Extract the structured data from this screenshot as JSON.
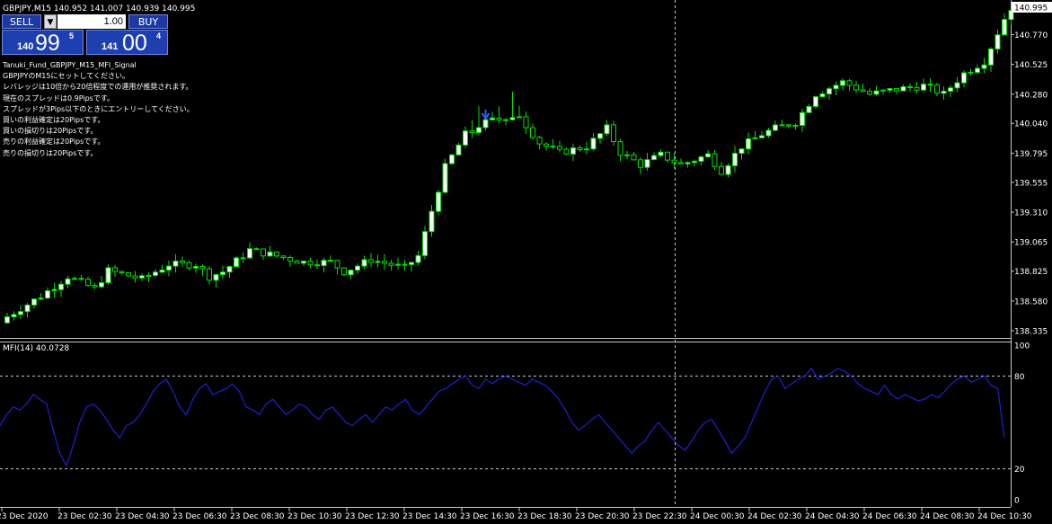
{
  "header": {
    "title": "GBPJPY,M15  140.952 141.007 140.939 140.995"
  },
  "trade_panel": {
    "sell_label": "SELL",
    "buy_label": "BUY",
    "lot": "1.00",
    "bid": {
      "small": "140",
      "big": "99",
      "sup": "5"
    },
    "ask": {
      "small": "141",
      "big": "00",
      "sup": "4"
    }
  },
  "notes": [
    "Tanuki_Fund_GBPJPY_M15_MFI_Signal",
    "GBPJPYのM15にセットしてください。",
    "レバレッジは10倍から20倍程度での運用が推奨されます。",
    "現在のスプレッドは0.9Pipsです。",
    "スプレッドが3Pips以下のときにエントリーしてください。",
    "買いの利益確定は20Pipsです。",
    "買いの損切りは20Pipsです。",
    "売りの利益確定は20Pipsです。",
    "売りの損切りは20Pipsです。"
  ],
  "colors": {
    "background": "#000000",
    "bull": "#ffffff",
    "bear": "#00e000",
    "wick": "#00e000",
    "mfi_line": "#2020d0",
    "signal_arrow": "#2060ff",
    "grid": "#c8c8c8",
    "axis_text": "#ffffff"
  },
  "chart_data": [
    {
      "type": "candlestick",
      "title": "GBPJPY,M15  140.952 141.007 140.939 140.995",
      "ylim": [
        138.335,
        140.995
      ],
      "y_ticks": [
        "140.770",
        "140.525",
        "140.280",
        "140.040",
        "139.795",
        "139.555",
        "139.310",
        "139.065",
        "138.825",
        "138.580",
        "138.335"
      ],
      "current_price": "140.995",
      "x_ticks": [
        "23 Dec 2020",
        "23 Dec 02:30",
        "23 Dec 04:30",
        "23 Dec 06:30",
        "23 Dec 08:30",
        "23 Dec 10:30",
        "23 Dec 12:30",
        "23 Dec 14:30",
        "23 Dec 16:30",
        "23 Dec 18:30",
        "23 Dec 20:30",
        "23 Dec 22:30",
        "24 Dec 00:30",
        "24 Dec 02:30",
        "24 Dec 04:30",
        "24 Dec 06:30",
        "24 Dec 08:30",
        "24 Dec 10:30"
      ],
      "close_path": [
        [
          0,
          138.45
        ],
        [
          5,
          138.62
        ],
        [
          9,
          138.78
        ],
        [
          13,
          138.68
        ],
        [
          15,
          138.83
        ],
        [
          20,
          138.76
        ],
        [
          24,
          138.88
        ],
        [
          28,
          138.88
        ],
        [
          30,
          138.78
        ],
        [
          32,
          138.82
        ],
        [
          36,
          139.0
        ],
        [
          40,
          138.95
        ],
        [
          44,
          138.9
        ],
        [
          48,
          138.9
        ],
        [
          50,
          138.82
        ],
        [
          54,
          138.92
        ],
        [
          59,
          138.85
        ],
        [
          61,
          138.95
        ],
        [
          63,
          139.32
        ],
        [
          65,
          139.68
        ],
        [
          68,
          139.95
        ],
        [
          71,
          140.05
        ],
        [
          76,
          140.1
        ],
        [
          79,
          139.88
        ],
        [
          82,
          139.8
        ],
        [
          86,
          139.85
        ],
        [
          89,
          140.0
        ],
        [
          91,
          139.8
        ],
        [
          94,
          139.7
        ],
        [
          97,
          139.78
        ],
        [
          100,
          139.7
        ],
        [
          104,
          139.78
        ],
        [
          106,
          139.65
        ],
        [
          109,
          139.85
        ],
        [
          112,
          139.95
        ],
        [
          114,
          140.0
        ],
        [
          117,
          140.05
        ],
        [
          120,
          140.28
        ],
        [
          124,
          140.38
        ],
        [
          128,
          140.28
        ],
        [
          132,
          140.32
        ],
        [
          136,
          140.35
        ],
        [
          139,
          140.28
        ],
        [
          142,
          140.45
        ],
        [
          145,
          140.55
        ],
        [
          148,
          140.9
        ],
        [
          149,
          140.99
        ]
      ],
      "signal_arrow": {
        "index": 71,
        "direction": "down"
      }
    },
    {
      "type": "line",
      "title": "MFI(14) 40.0728",
      "ylim": [
        0,
        100
      ],
      "y_ticks": [
        "100",
        "80",
        "20",
        "0"
      ],
      "levels": [
        80,
        20
      ],
      "series": [
        {
          "values": [
            48,
            55,
            60,
            58,
            62,
            68,
            65,
            62,
            45,
            30,
            22,
            35,
            50,
            60,
            62,
            58,
            52,
            45,
            40,
            48,
            50,
            55,
            62,
            70,
            75,
            78,
            70,
            60,
            55,
            65,
            72,
            75,
            68,
            70,
            72,
            75,
            70,
            60,
            58,
            55,
            62,
            65,
            60,
            55,
            58,
            62,
            60,
            55,
            52,
            58,
            60,
            55,
            50,
            48,
            52,
            55,
            50,
            55,
            60,
            58,
            62,
            65,
            58,
            55,
            60,
            65,
            70,
            72,
            75,
            78,
            80,
            74,
            72,
            78,
            75,
            78,
            80,
            78,
            76,
            74,
            78,
            76,
            74,
            70,
            65,
            58,
            50,
            45,
            48,
            52,
            55,
            50,
            45,
            40,
            35,
            30,
            35,
            38,
            45,
            50,
            45,
            40,
            35,
            32,
            38,
            45,
            50,
            52,
            45,
            38,
            30,
            35,
            40,
            50,
            60,
            70,
            78,
            80,
            72,
            75,
            78,
            80,
            85,
            78,
            80,
            82,
            85,
            83,
            80,
            75,
            72,
            70,
            68,
            74,
            68,
            65,
            68,
            66,
            64,
            65,
            68,
            66,
            70,
            75,
            78,
            80,
            76,
            78,
            80,
            74,
            72,
            40
          ]
        }
      ]
    }
  ]
}
